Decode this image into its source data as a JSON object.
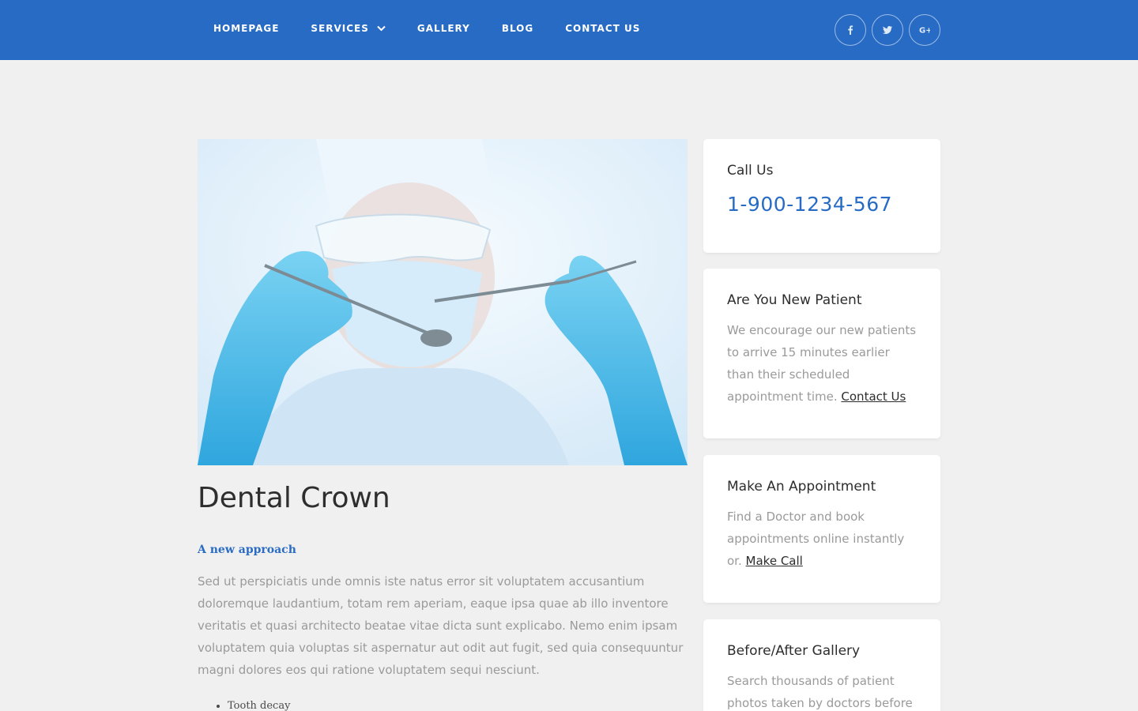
{
  "nav": {
    "items": [
      {
        "label": "HOMEPAGE"
      },
      {
        "label": "SERVICES",
        "has_dropdown": true
      },
      {
        "label": "GALLERY"
      },
      {
        "label": "BLOG"
      },
      {
        "label": "CONTACT US"
      }
    ]
  },
  "social": [
    "facebook-icon",
    "twitter-icon",
    "google-plus-icon"
  ],
  "colors": {
    "brand": "#276bc4",
    "background": "#f0f0f0",
    "text_muted": "#9a9a9a"
  },
  "main": {
    "hero_image": "dentist-with-tools",
    "title": "Dental Crown",
    "subtitle": "A new approach",
    "body": "Sed ut perspiciatis unde omnis iste natus error sit voluptatem accusantium doloremque laudantium, totam rem aperiam, eaque ipsa quae ab illo inventore veritatis et quasi architecto beatae vitae dicta sunt explicabo. Nemo enim ipsam voluptatem quia voluptas sit aspernatur aut odit aut fugit, sed quia consequuntur magni dolores eos qui ratione voluptatem sequi nesciunt.",
    "bullets": [
      "Tooth decay"
    ]
  },
  "sidebar": {
    "call": {
      "title": "Call Us",
      "phone": "1-900-1234-567"
    },
    "new_patient": {
      "title": "Are You New Patient",
      "text": "We encourage our new patients to arrive 15 minutes earlier than their scheduled appointment time.",
      "link": "Contact Us"
    },
    "appointment": {
      "title": "Make An Appointment",
      "text": "Find a Doctor and book appointments online instantly or.",
      "link": "Make Call"
    },
    "gallery": {
      "title": "Before/After Gallery",
      "text": "Search thousands of patient photos taken by doctors before"
    }
  }
}
